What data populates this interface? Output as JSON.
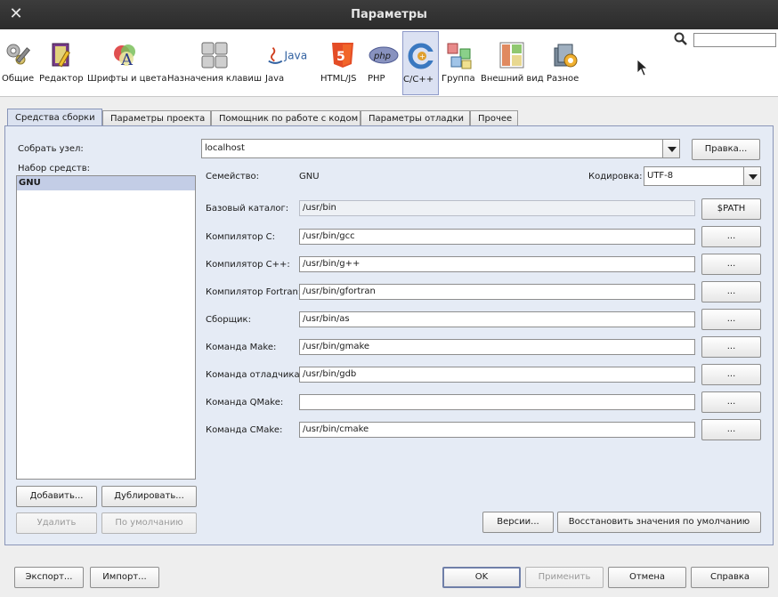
{
  "window": {
    "title": "Параметры",
    "close_glyph": "✕"
  },
  "categories": [
    {
      "label": "Общие",
      "icon": "wrench-gears-icon"
    },
    {
      "label": "Редактор",
      "icon": "editor-book-icon"
    },
    {
      "label": "Шрифты и цвета",
      "icon": "font-palette-icon"
    },
    {
      "label": "Назначения клавиш",
      "icon": "keyboard-icon"
    },
    {
      "label": "Java",
      "icon": "java-icon"
    },
    {
      "label": "HTML/JS",
      "icon": "html5-icon"
    },
    {
      "label": "PHP",
      "icon": "php-icon"
    },
    {
      "label": "C/C++",
      "icon": "cpp-icon",
      "active": true
    },
    {
      "label": "Группа",
      "icon": "cubes-icon"
    },
    {
      "label": "Внешний вид",
      "icon": "layout-icon"
    },
    {
      "label": "Разное",
      "icon": "misc-icon"
    }
  ],
  "search": {
    "value": ""
  },
  "tabs": [
    {
      "label": "Средства сборки",
      "active": true
    },
    {
      "label": "Параметры проекта"
    },
    {
      "label": "Помощник по работе с кодом"
    },
    {
      "label": "Параметры отладки"
    },
    {
      "label": "Прочее"
    }
  ],
  "build": {
    "host_label": "Собрать узел:",
    "host_value": "localhost",
    "edit_button": "Правка...",
    "toolset_label": "Набор средств:",
    "toolsets": [
      "GNU"
    ],
    "family_label": "Семейство:",
    "family_value": "GNU",
    "encoding_label": "Кодировка:",
    "encoding_value": "UTF-8",
    "base_label": "Базовый каталог:",
    "base_value": "/usr/bin",
    "path_button": "$PATH",
    "browse_label": "...",
    "rows": [
      {
        "label": "Компилятор C:",
        "value": "/usr/bin/gcc"
      },
      {
        "label": "Компилятор C++:",
        "value": "/usr/bin/g++"
      },
      {
        "label": "Компилятор Fortran:",
        "value": "/usr/bin/gfortran"
      },
      {
        "label": "Сборщик:",
        "value": "/usr/bin/as"
      },
      {
        "label": "Команда Make:",
        "value": "/usr/bin/gmake"
      },
      {
        "label": "Команда отладчика:",
        "value": "/usr/bin/gdb"
      },
      {
        "label": "Команда QMake:",
        "value": ""
      },
      {
        "label": "Команда CMake:",
        "value": "/usr/bin/cmake"
      }
    ],
    "add_button": "Добавить...",
    "duplicate_button": "Дублировать...",
    "remove_button": "Удалить",
    "default_button": "По умолчанию",
    "versions_button": "Версии...",
    "restore_button": "Восстановить значения по умолчанию"
  },
  "footer": {
    "export": "Экспорт...",
    "import": "Импорт...",
    "ok": "OK",
    "apply": "Применить",
    "cancel": "Отмена",
    "help": "Справка"
  }
}
